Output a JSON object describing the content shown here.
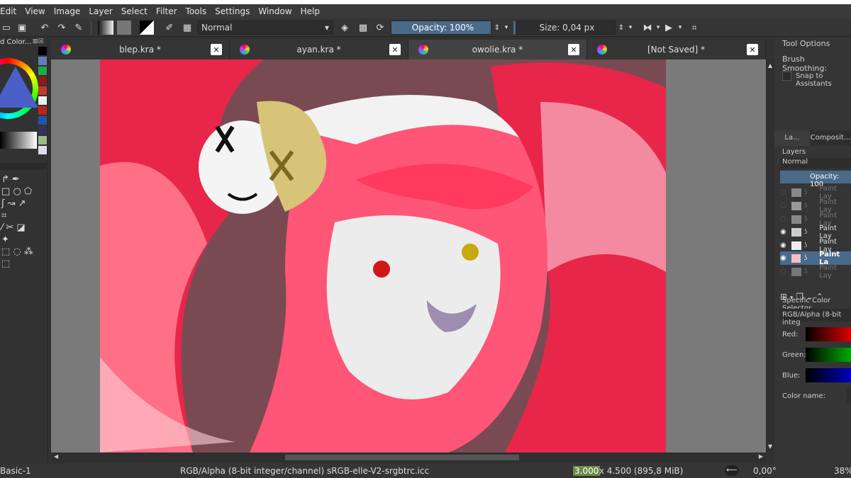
{
  "menu": [
    "Edit",
    "View",
    "Image",
    "Layer",
    "Select",
    "Filter",
    "Tools",
    "Settings",
    "Window",
    "Help"
  ],
  "toolbar": {
    "blend_mode": "Normal",
    "opacity": "Opacity: 100%",
    "size": "Size: 0,04 px"
  },
  "docker_left": {
    "title": "d Color..."
  },
  "tabs": [
    {
      "label": "blep.kra *",
      "close": "✕"
    },
    {
      "label": "ayan.kra *",
      "close": "✕"
    },
    {
      "label": "owolie.kra *",
      "close": "✕"
    },
    {
      "label": "[Not Saved]  *",
      "close": "✕"
    }
  ],
  "tool_options": {
    "title": "Tool Options",
    "brush_smoothing": "Brush Smoothing:",
    "snap": "Snap to Assistants"
  },
  "layers_panel": {
    "tab1": "La...",
    "tab2": "Composit...",
    "title": "Layers",
    "blend": "Normal",
    "opacity": "Opacity:  100",
    "layers": [
      {
        "name": "Paint Lay"
      },
      {
        "name": "Paint Lay"
      },
      {
        "name": "Paint Lay"
      },
      {
        "name": "Paint Lay"
      },
      {
        "name": "Paint Lay"
      },
      {
        "name": "Paint La"
      },
      {
        "name": "Paint Lay"
      }
    ]
  },
  "color_selector": {
    "title": "Specific Color Selector",
    "space": "RGB/Alpha (8-bit integ",
    "red": "Red:",
    "green": "Green:",
    "blue": "Blue:",
    "name": "Color name:"
  },
  "status": {
    "brush": "Basic-1",
    "colorspace": "RGB/Alpha (8-bit integer/channel)  sRGB-elle-V2-srgbtrc.icc",
    "dims_w": "3.000",
    "dims_rest": " x 4.500 (895,8 MiB)",
    "rotation": "0,00°",
    "zoom": "38%"
  },
  "colors": {
    "accent": "#4a6a8a",
    "hair": "#e8264a",
    "bg": "#7a4a52"
  }
}
